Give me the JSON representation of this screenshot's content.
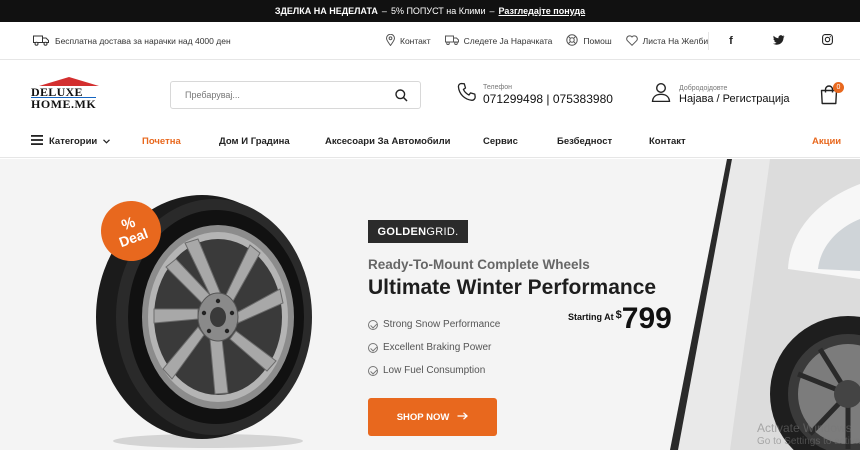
{
  "promo": {
    "prefix": "ЗДЕЛКА НА НЕДЕЛАТА",
    "dash1": "–",
    "text": "5% ПОПУСТ на Клими",
    "dash2": "–",
    "link": "Разгледајте понуда"
  },
  "util": {
    "shipping": "Бесплатна достава за нарачки над 4000 ден",
    "links": [
      {
        "label": "Контакт",
        "icon": "location-pin-icon"
      },
      {
        "label": "Следете Ја Нарачката",
        "icon": "delivery-truck-icon"
      },
      {
        "label": "Помош",
        "icon": "help-icon"
      },
      {
        "label": "Листа На Желби",
        "icon": "heart-icon"
      }
    ],
    "social": [
      "f",
      "t",
      "ig"
    ]
  },
  "header": {
    "logo_line1": "DELUXE",
    "logo_line2": "HOME.MK",
    "search_placeholder": "Пребарувај...",
    "phone_label": "Телефон",
    "phone_numbers": "071299498 | 075383980",
    "account_label": "Добродојдовте",
    "account_links": "Најава / Регистрација",
    "cart_count": "0"
  },
  "nav": {
    "categories": "Категории",
    "items": [
      "Почетна",
      "Дом И Градина",
      "Аксесоари За Автомобили",
      "Сервис",
      "Безбедност",
      "Контакт"
    ],
    "promo": "Акции"
  },
  "hero": {
    "deal_pct": "%",
    "deal_word": "Deal",
    "brand_bold": "GOLDEN",
    "brand_light": "GRID.",
    "subtitle": "Ready-To-Mount Complete Wheels",
    "title": "Ultimate Winter Performance",
    "features": [
      "Strong Snow Performance",
      "Excellent Braking Power",
      "Low Fuel Consumption"
    ],
    "starting_at": "Starting At",
    "currency": "$",
    "price": "799",
    "cta": "SHOP NOW",
    "watermark_line1": "Activate Windows",
    "watermark_line2": "Go to Settings to activate"
  },
  "colors": {
    "accent": "#e8681e",
    "dark": "#111111",
    "brand_box": "#2b2b2b"
  }
}
